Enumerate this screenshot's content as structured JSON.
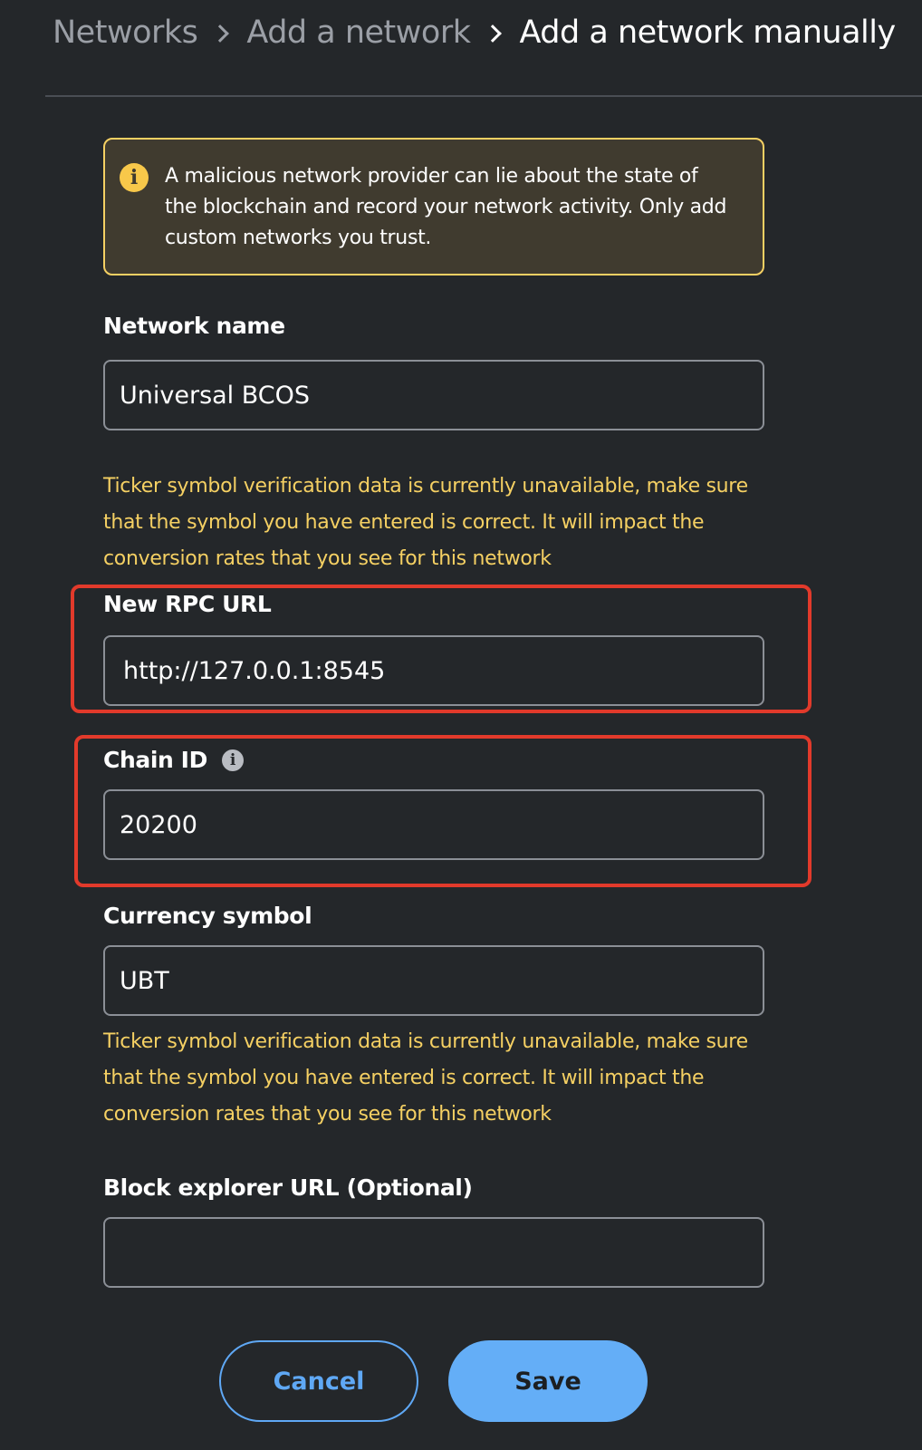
{
  "breadcrumb": {
    "items": [
      "Networks",
      "Add a network",
      "Add a network manually"
    ]
  },
  "warning": {
    "icon": "info-icon",
    "text": "A malicious network provider can lie about the state of the blockchain and record your network activity. Only add custom networks you trust."
  },
  "fields": {
    "network_name": {
      "label": "Network name",
      "value": "Universal BCOS"
    },
    "rpc_url": {
      "label": "New RPC URL",
      "value": "http://127.0.0.1:8545"
    },
    "chain_id": {
      "label": "Chain ID",
      "value": "20200"
    },
    "currency_symbol": {
      "label": "Currency symbol",
      "value": "UBT"
    },
    "block_explorer": {
      "label": "Block explorer URL (Optional)",
      "value": ""
    }
  },
  "ticker_warning_text": "Ticker symbol verification data is currently unavailable, make sure that the symbol you have entered is correct. It will impact the conversion rates that you see for this network",
  "buttons": {
    "cancel": "Cancel",
    "save": "Save"
  },
  "colors": {
    "background": "#24272a",
    "warning_border": "#f5d063",
    "warning_text": "#f5d063",
    "highlight": "#e23a2b",
    "primary": "#64aef7"
  }
}
